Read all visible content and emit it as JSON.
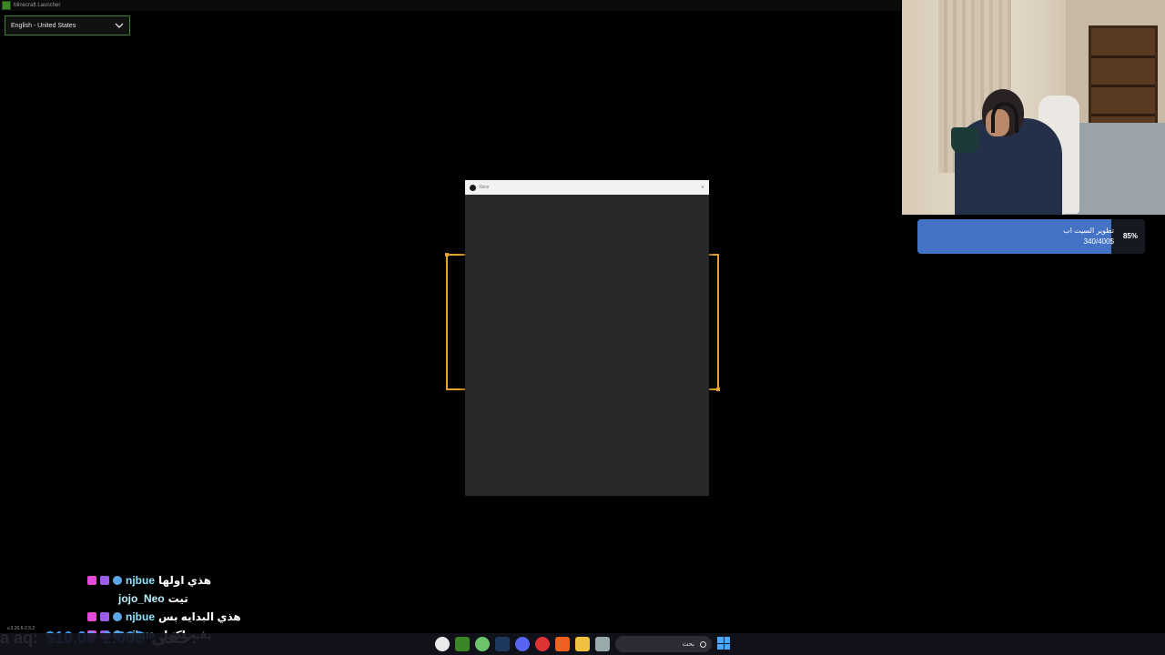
{
  "window": {
    "title": "Minecraft Launcher"
  },
  "language_select": {
    "value": "English - United States"
  },
  "dialog": {
    "title": "Xbox",
    "close_label": "×"
  },
  "goal": {
    "title": "تطوير السيت اب",
    "amount": "340/400$",
    "percent_label": "85%",
    "progress": 0.85
  },
  "chat": {
    "messages": [
      {
        "user": "njbue",
        "text": "هذي اولها",
        "badges": true
      },
      {
        "user": "jojo_Neo",
        "text": "تيت",
        "badges": false
      },
      {
        "user": "njbue",
        "text": "هذي البدايه بس",
        "badges": true
      },
      {
        "user": "njbue",
        "text": "يفيه اكمل",
        "badges": true
      }
    ]
  },
  "version": "v.3.26.6-2.5.2",
  "ticker": {
    "name": "a aq:",
    "amount": "$10.00",
    "amount2": "2.00$",
    "user": "خفي:"
  },
  "taskbar": {
    "search_placeholder": "بحث"
  },
  "colors": {
    "accent_green": "#3c8527",
    "frame_gold": "#e6a22d",
    "goal_blue": "#4473c6"
  }
}
